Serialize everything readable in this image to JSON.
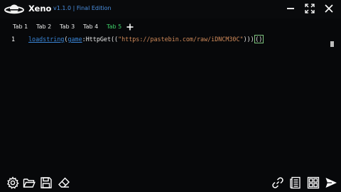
{
  "app": {
    "name": "Xeno",
    "version_text": "v1.1.0 | Final Edition"
  },
  "tabs": [
    {
      "label": "Tab 1",
      "active": false
    },
    {
      "label": "Tab 2",
      "active": false
    },
    {
      "label": "Tab 3",
      "active": false
    },
    {
      "label": "Tab 4",
      "active": false
    },
    {
      "label": "Tab 5",
      "active": true
    }
  ],
  "editor": {
    "line_number": "1",
    "code": {
      "fn": "loadstring",
      "open_paren": "(",
      "obj": "game",
      "colon": ":",
      "method": "HttpGet",
      "open2": "((",
      "url": "\"https://pastebin.com/raw/iDNCM30C\"",
      "close": ")))",
      "cursor_parens": "()"
    }
  },
  "icons": {
    "logo": "saturn-logo",
    "minimize": "minus-icon",
    "expand": "expand-icon",
    "close": "close-icon",
    "add_tab": "plus-icon",
    "settings": "gear-icon",
    "open": "folder-icon",
    "save": "save-icon",
    "clear": "eraser-icon",
    "attach": "link-icon",
    "script_list": "script-icon",
    "hub": "grid-icon",
    "execute": "send-icon"
  },
  "colors": {
    "background": "#07080a",
    "accent": "#4a8fe0",
    "active_tab": "#3fd16a",
    "string": "#d18b5a",
    "keyword_fn": "#3a86d8"
  }
}
